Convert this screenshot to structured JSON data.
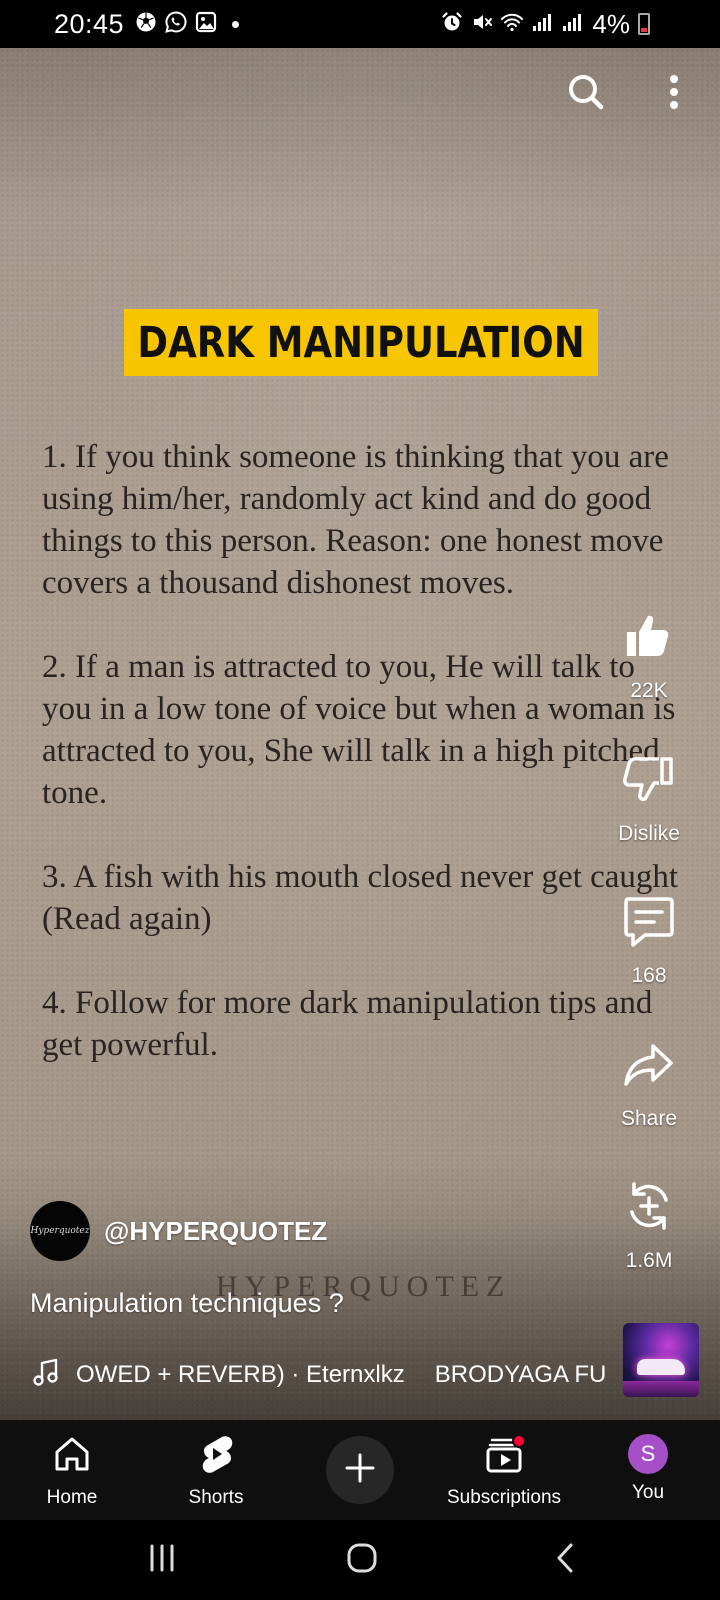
{
  "status_bar": {
    "time": "20:45",
    "left_icons": [
      "soccer-ball-icon",
      "whatsapp-icon",
      "gallery-icon",
      "dot-icon"
    ],
    "right_icons": [
      "alarm-icon",
      "mute-icon",
      "wifi-icon",
      "signal-icon",
      "signal-icon"
    ],
    "battery": "4%",
    "battery_color": "#e53935"
  },
  "video": {
    "banner_title": "DARK MANIPULATION",
    "banner_color": "#f7c600",
    "quotes": [
      "1. If you think someone is thinking that you are using him/her, randomly act kind and do good things to this person. Reason: one honest move covers a thousand dishonest moves.",
      "2. If a man is attracted to you, He will talk to you in a low tone of voice but when a woman is attracted to you, She will talk in a high pitched tone.",
      "3. A fish with his mouth closed never get caught (Read again)",
      "4. Follow for more dark manipulation tips and get powerful."
    ],
    "watermark": "HYPERQUOTEZ"
  },
  "top_actions": {
    "search_icon": "search-icon",
    "more_icon": "more-vertical-icon"
  },
  "actions": {
    "like_count": "22K",
    "dislike_label": "Dislike",
    "comment_count": "168",
    "share_label": "Share",
    "remix_count": "1.6M"
  },
  "channel": {
    "avatar_text": "Hyperquotez",
    "handle": "@HYPERQUOTEZ"
  },
  "video_title": "Manipulation techniques ?",
  "music": {
    "track_part1": "OWED + REVERB) · Eternxlkz",
    "track_part2": "BRODYAGA FU"
  },
  "bottom_nav": {
    "home": "Home",
    "shorts": "Shorts",
    "subscriptions": "Subscriptions",
    "you": "You",
    "you_initial": "S",
    "accent": "#ff0033",
    "avatar_color": "#a64fc9"
  },
  "system_nav": [
    "recents-icon",
    "home-circle-icon",
    "back-icon"
  ]
}
